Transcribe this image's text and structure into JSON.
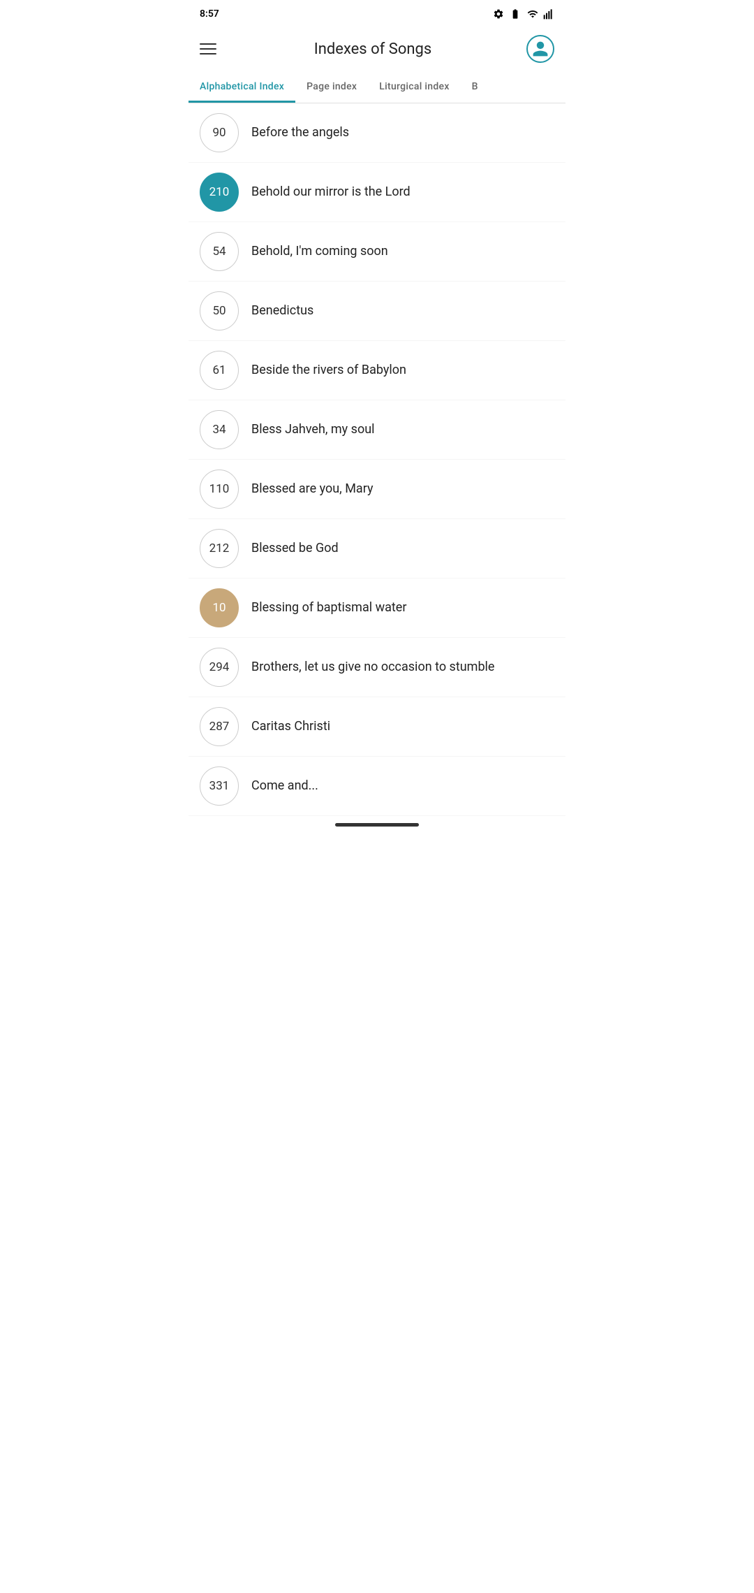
{
  "statusBar": {
    "time": "8:57"
  },
  "header": {
    "title": "Indexes of Songs",
    "menuLabel": "menu",
    "avatarLabel": "user profile"
  },
  "tabs": [
    {
      "id": "alphabetical",
      "label": "Alphabetical Index",
      "active": true
    },
    {
      "id": "page",
      "label": "Page index",
      "active": false
    },
    {
      "id": "liturgical",
      "label": "Liturgical index",
      "active": false
    },
    {
      "id": "b",
      "label": "B",
      "active": false
    }
  ],
  "songs": [
    {
      "number": "90",
      "title": "Before the angels",
      "highlight": "none"
    },
    {
      "number": "210",
      "title": "Behold our mirror is the Lord",
      "highlight": "teal"
    },
    {
      "number": "54",
      "title": "Behold, I'm coming soon",
      "highlight": "none"
    },
    {
      "number": "50",
      "title": "Benedictus",
      "highlight": "none"
    },
    {
      "number": "61",
      "title": "Beside the rivers of Babylon",
      "highlight": "none"
    },
    {
      "number": "34",
      "title": "Bless Jahveh, my soul",
      "highlight": "none"
    },
    {
      "number": "110",
      "title": "Blessed are you, Mary",
      "highlight": "none"
    },
    {
      "number": "212",
      "title": "Blessed be God",
      "highlight": "none"
    },
    {
      "number": "10",
      "title": "Blessing of baptismal water",
      "highlight": "tan"
    },
    {
      "number": "294",
      "title": "Brothers, let us give no occasion to stumble",
      "highlight": "none"
    },
    {
      "number": "287",
      "title": "Caritas Christi",
      "highlight": "none"
    },
    {
      "number": "331",
      "title": "Come and...",
      "highlight": "none"
    }
  ],
  "colors": {
    "accent": "#2196a6",
    "tan": "#c8a87a"
  }
}
